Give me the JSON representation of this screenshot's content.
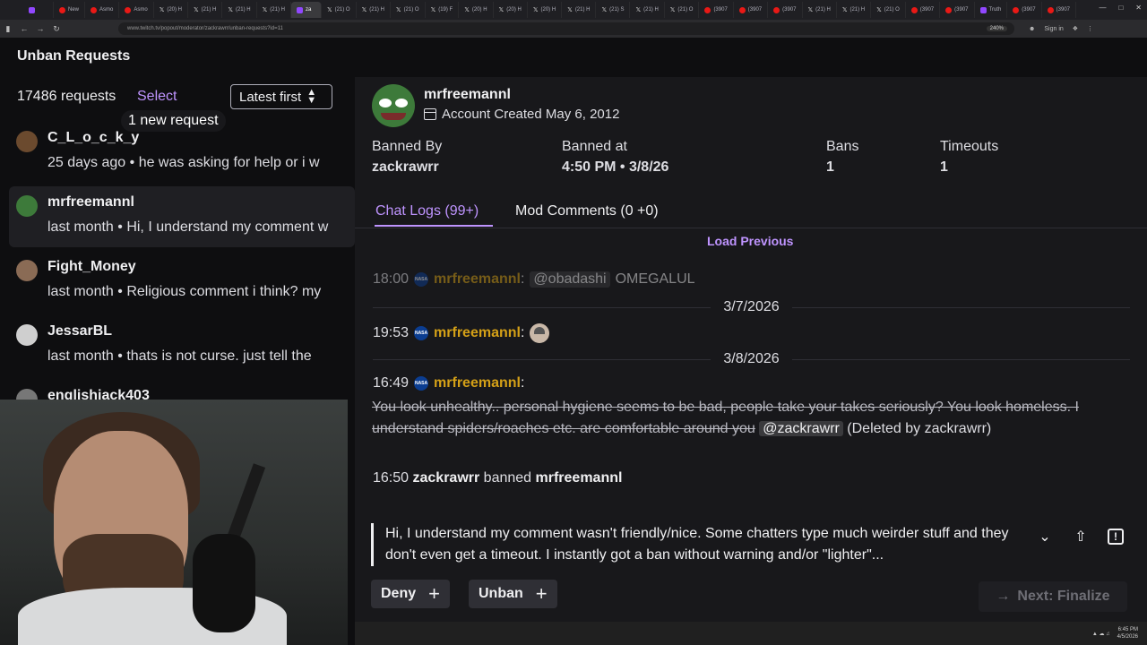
{
  "browser": {
    "tabs": [
      {
        "label": "",
        "kind": "fav"
      },
      {
        "label": "New",
        "kind": "red"
      },
      {
        "label": "Asmo",
        "kind": "red"
      },
      {
        "label": "Asmo",
        "kind": "red"
      },
      {
        "label": "(20) H",
        "kind": "x"
      },
      {
        "label": "(21) H",
        "kind": "x"
      },
      {
        "label": "(21) H",
        "kind": "x"
      },
      {
        "label": "(21) H",
        "kind": "x"
      },
      {
        "label": "za",
        "kind": "active"
      },
      {
        "label": "(21) O",
        "kind": "x"
      },
      {
        "label": "(21) H",
        "kind": "x"
      },
      {
        "label": "(21) O",
        "kind": "x"
      },
      {
        "label": "(19) F",
        "kind": "x"
      },
      {
        "label": "(20) H",
        "kind": "x"
      },
      {
        "label": "(20) H",
        "kind": "x"
      },
      {
        "label": "(20) H",
        "kind": "x"
      },
      {
        "label": "(21) H",
        "kind": "x"
      },
      {
        "label": "(21) S",
        "kind": "x"
      },
      {
        "label": "(21) H",
        "kind": "x"
      },
      {
        "label": "(21) O",
        "kind": "x"
      },
      {
        "label": "(3907",
        "kind": "red"
      },
      {
        "label": "(3907",
        "kind": "red"
      },
      {
        "label": "(3907",
        "kind": "red"
      },
      {
        "label": "(21) H",
        "kind": "x"
      },
      {
        "label": "(21) H",
        "kind": "x"
      },
      {
        "label": "(21) O",
        "kind": "x"
      },
      {
        "label": "(3907",
        "kind": "red"
      },
      {
        "label": "(3907",
        "kind": "red"
      },
      {
        "label": "Truth",
        "kind": "fav"
      },
      {
        "label": "(3907",
        "kind": "red"
      },
      {
        "label": "(3907",
        "kind": "red"
      }
    ],
    "url": "www.twitch.tv/popout/moderator/zackrawrr/unban-requests?id=11",
    "zoom": "240%",
    "sign_in": "Sign in"
  },
  "header": {
    "title": "Unban Requests"
  },
  "left": {
    "count": "17486 requests",
    "select": "Select",
    "sort": "Latest first",
    "new_badge": "1 new request",
    "requests": [
      {
        "name": "C_L_o_c_k_y",
        "meta": "25 days ago",
        "preview": "he was asking for help or i w",
        "avatar_color": "#6b4a2e"
      },
      {
        "name": "mrfreemannl",
        "meta": "last month",
        "preview": "Hi, I understand my comment w",
        "avatar_color": "#3d7a3a"
      },
      {
        "name": "Fight_Money",
        "meta": "last month",
        "preview": "Religious comment i think? my",
        "avatar_color": "#8a6b55"
      },
      {
        "name": "JessarBL",
        "meta": "last month",
        "preview": "thats is not curse. just tell the",
        "avatar_color": "#cfcfcf"
      },
      {
        "name": "englishjack403",
        "meta": "",
        "preview": "",
        "avatar_color": "#777777"
      }
    ]
  },
  "detail": {
    "username": "mrfreemannl",
    "account_created": "Account Created May 6, 2012",
    "stats": [
      {
        "label": "Banned By",
        "value": "zackrawrr"
      },
      {
        "label": "Banned at",
        "value": "4:50 PM • 3/8/26"
      },
      {
        "label": "Bans",
        "value": "1"
      },
      {
        "label": "Timeouts",
        "value": "1"
      }
    ],
    "tabs": {
      "chat": "Chat Logs (99+)",
      "mod": "Mod Comments (0 +0)"
    },
    "load_previous": "Load Previous",
    "chat": {
      "line1": {
        "time": "18:00",
        "user": "mrfreemannl",
        "mention": "@obadashi",
        "text": "OMEGALUL"
      },
      "date1": "3/7/2026",
      "line2": {
        "time": "19:53",
        "user": "mrfreemannl"
      },
      "date2": "3/8/2026",
      "line3": {
        "time": "16:49",
        "user": "mrfreemannl"
      },
      "deleted_text": "You look unhealthy.. personal hygiene seems to be bad, people take your takes seriously? You look homeless. I understand spiders/roaches etc. are comfortable around you",
      "deleted_mention": "@zackrawrr",
      "deleted_note": "(Deleted by zackrawrr)",
      "ban": {
        "time": "16:50",
        "mod": "zackrawrr",
        "action": "banned",
        "target": "mrfreemannl"
      }
    },
    "request_text": "Hi, I understand my comment wasn't friendly/nice. Some chatters type much weirder stuff and they don't even get a timeout. I instantly got a ban without warning and/or \"lighter\"...",
    "actions": {
      "deny": "Deny",
      "unban": "Unban",
      "next": "Next: Finalize"
    }
  },
  "taskbar": {
    "time": "6:45 PM",
    "date": "4/5/2026"
  }
}
